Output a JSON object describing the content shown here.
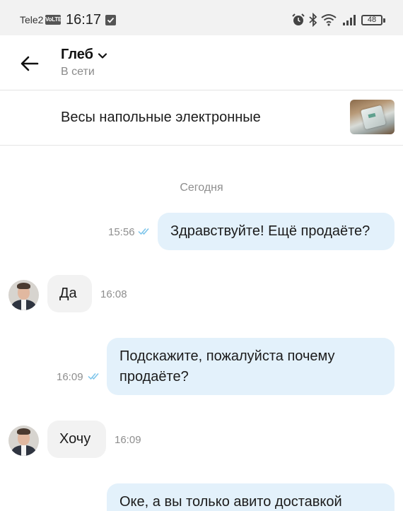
{
  "status_bar": {
    "carrier": "Tele2",
    "volte": "VoLTE",
    "time": "16:17",
    "battery": "48"
  },
  "header": {
    "contact_name": "Глеб",
    "contact_status": "В сети"
  },
  "listing": {
    "title": "Весы напольные электронные"
  },
  "chat": {
    "date_separator": "Сегодня",
    "messages": [
      {
        "direction": "outgoing",
        "text": "Здравствуйте! Ещё продаёте?",
        "time": "15:56",
        "read": true
      },
      {
        "direction": "incoming",
        "text": "Да",
        "time": "16:08"
      },
      {
        "direction": "outgoing",
        "text_lines": [
          "Подскажите, пожалуйста почему",
          "продаёте?"
        ],
        "time": "16:09",
        "read": true
      },
      {
        "direction": "incoming",
        "text": "Хочу",
        "time": "16:09"
      },
      {
        "direction": "outgoing",
        "text": "Оке, а вы только авито доставкой"
      }
    ]
  },
  "colors": {
    "outgoing_bubble": "#e3f1fb",
    "incoming_bubble": "#f2f2f2",
    "read_ticks": "#7cc4ea",
    "muted_text": "#8e8e8e"
  }
}
